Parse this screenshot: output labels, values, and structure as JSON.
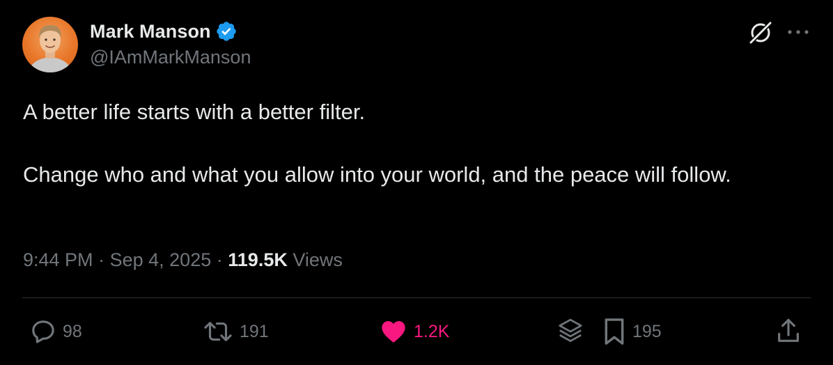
{
  "author": {
    "display_name": "Mark Manson",
    "handle": "@IAmMarkManson",
    "verified": true
  },
  "tweet": {
    "paragraphs": [
      "A better life starts with a better filter.",
      "Change who and what you allow into your world, and the peace will follow."
    ],
    "time": "9:44 PM",
    "separator": "·",
    "date": "Sep 4, 2025",
    "views_count": "119.5K",
    "views_label": "Views"
  },
  "actions": {
    "replies": "98",
    "reposts": "191",
    "likes": "1.2K",
    "bookmarks": "195"
  },
  "icons": {
    "verified": "verified-badge-icon",
    "grok": "grok-icon",
    "more": "more-icon",
    "reply": "reply-icon",
    "repost": "repost-icon",
    "like": "heart-icon",
    "grok_stack": "layers-icon",
    "bookmark": "bookmark-icon",
    "share": "share-icon"
  },
  "colors": {
    "background": "#000000",
    "text_primary": "#e7e9ea",
    "text_secondary": "#71767b",
    "verified_blue": "#1d9bf0",
    "like_pink": "#f91880",
    "divider": "#2f3336"
  }
}
